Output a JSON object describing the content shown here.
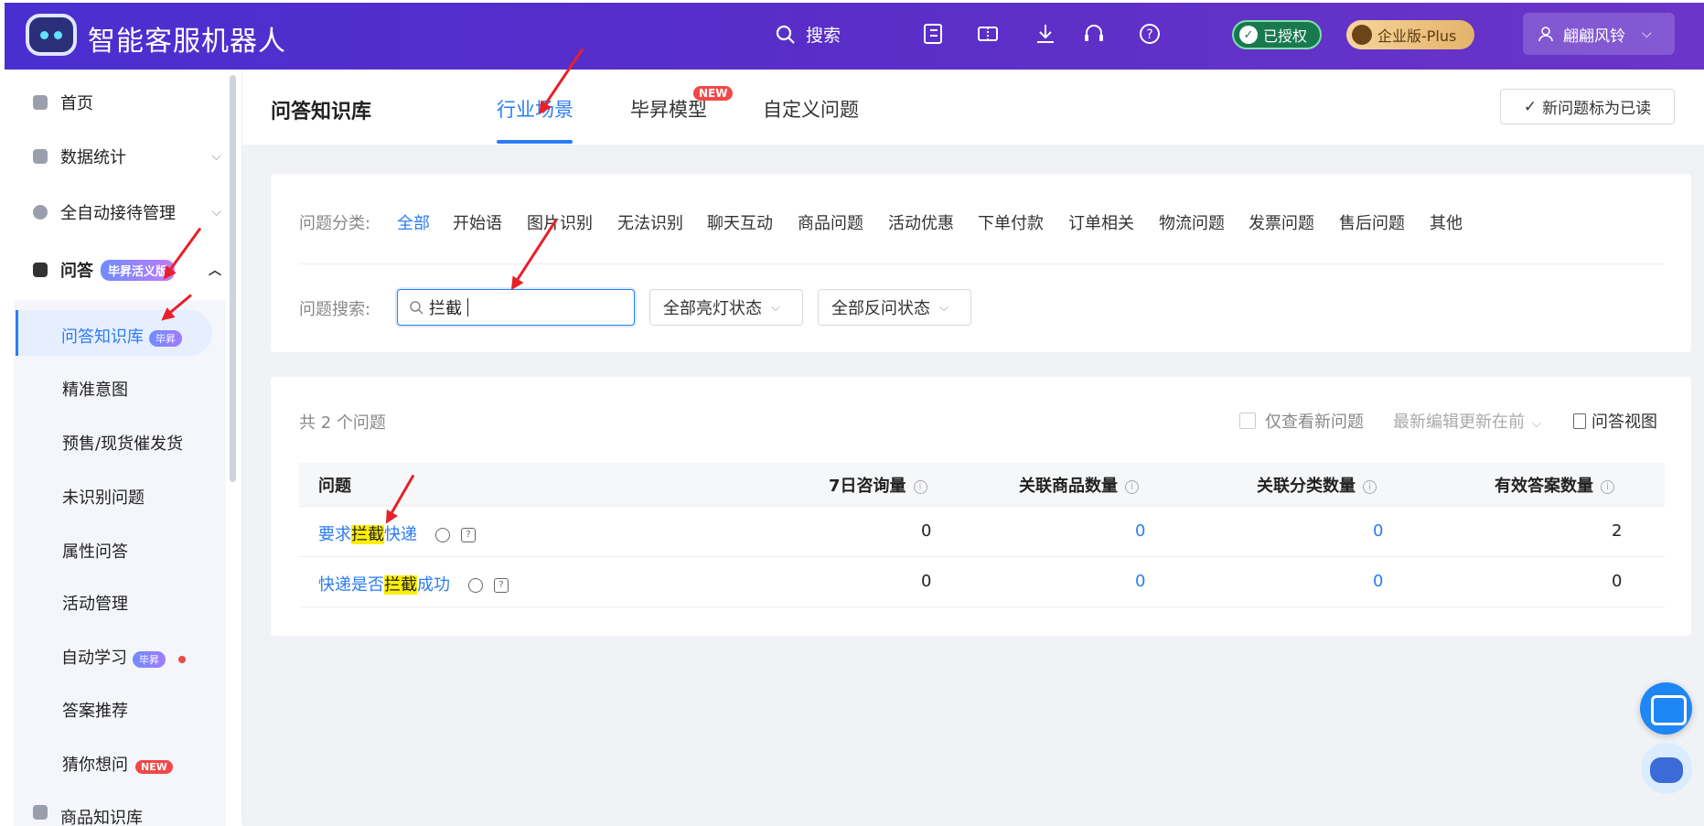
{
  "app": {
    "title": "智能客服机器人"
  },
  "topbar": {
    "search_label": "搜索",
    "auth_badge": "已授权",
    "plan_badge": "企业版-Plus",
    "user_name": "翩翩风铃",
    "icons": [
      "list-check-icon",
      "ticket-icon",
      "download-icon",
      "headset-icon",
      "help-icon"
    ]
  },
  "sidebar": {
    "items": [
      {
        "label": "首页"
      },
      {
        "label": "数据统计"
      },
      {
        "label": "全自动接待管理"
      },
      {
        "label": "问答",
        "badge": "毕昇活义版"
      }
    ],
    "sub_items": [
      {
        "label": "问答知识库",
        "badge": "毕昇"
      },
      {
        "label": "精准意图"
      },
      {
        "label": "预售/现货催发货"
      },
      {
        "label": "未识别问题"
      },
      {
        "label": "属性问答"
      },
      {
        "label": "活动管理"
      },
      {
        "label": "自动学习",
        "badge": "毕昇"
      },
      {
        "label": "答案推荐"
      },
      {
        "label": "猜你想问",
        "badge": "NEW"
      }
    ],
    "more": "商品知识库"
  },
  "header": {
    "title": "问答知识库",
    "tabs": [
      {
        "label": "行业场景"
      },
      {
        "label": "毕昇模型",
        "badge": "NEW"
      },
      {
        "label": "自定义问题"
      }
    ],
    "mark_read": "新问题标为已读"
  },
  "filters": {
    "category_label": "问题分类:",
    "categories": [
      "全部",
      "开始语",
      "图片识别",
      "无法识别",
      "聊天互动",
      "商品问题",
      "活动优惠",
      "下单付款",
      "订单相关",
      "物流问题",
      "发票问题",
      "售后问题",
      "其他"
    ],
    "search_label": "问题搜索:",
    "search_value": "拦截",
    "light_status": "全部亮灯状态",
    "feedback_status": "全部反问状态"
  },
  "results": {
    "total": "共 2 个问题",
    "only_new": "仅查看新问题",
    "sort": "最新编辑更新在前",
    "view": "问答视图",
    "columns": [
      "问题",
      "7日咨询量",
      "关联商品数量",
      "关联分类数量",
      "有效答案数量"
    ],
    "rows": [
      {
        "pre": "要求",
        "hl": "拦截",
        "post": "快递",
        "c7": "0",
        "goods": "0",
        "cats": "0",
        "answers": "2"
      },
      {
        "pre": "快递是否",
        "hl": "拦截",
        "post": "成功",
        "c7": "0",
        "goods": "0",
        "cats": "0",
        "answers": "0"
      }
    ]
  }
}
